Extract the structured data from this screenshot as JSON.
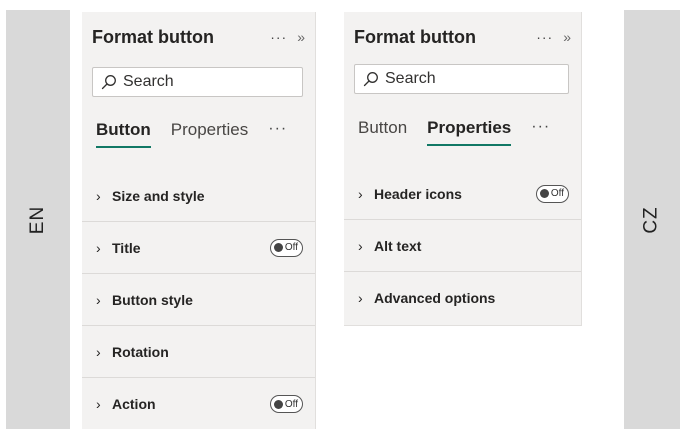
{
  "left_label": "EN",
  "right_label": "CZ",
  "en_pane": {
    "title": "Format button",
    "more": "···",
    "collapse": "»",
    "search_placeholder": "Search",
    "tabs": [
      {
        "label": "Button",
        "active": true
      },
      {
        "label": "Properties",
        "active": false
      }
    ],
    "tabs_more": "···",
    "sections": [
      {
        "label": "Size and style",
        "toggle": null
      },
      {
        "label": "Title",
        "toggle": "Off"
      },
      {
        "label": "Button style",
        "toggle": null
      },
      {
        "label": "Rotation",
        "toggle": null
      },
      {
        "label": "Action",
        "toggle": "Off"
      }
    ]
  },
  "cz_pane": {
    "title": "Format button",
    "more": "···",
    "collapse": "»",
    "search_placeholder": "Search",
    "tabs": [
      {
        "label": "Button",
        "active": false
      },
      {
        "label": "Properties",
        "active": true
      }
    ],
    "tabs_more": "···",
    "sections": [
      {
        "label": "Header icons",
        "toggle": "Off"
      },
      {
        "label": "Alt text",
        "toggle": null
      },
      {
        "label": "Advanced options",
        "toggle": null
      }
    ]
  },
  "colors": {
    "accent": "#117865",
    "pane_bg": "#f3f2f1",
    "side_bar": "#d9d9d9"
  },
  "icons": {
    "search": "search-icon",
    "chevron": "chevron-right-icon",
    "more": "more-icon",
    "collapse": "collapse-pane-icon"
  }
}
